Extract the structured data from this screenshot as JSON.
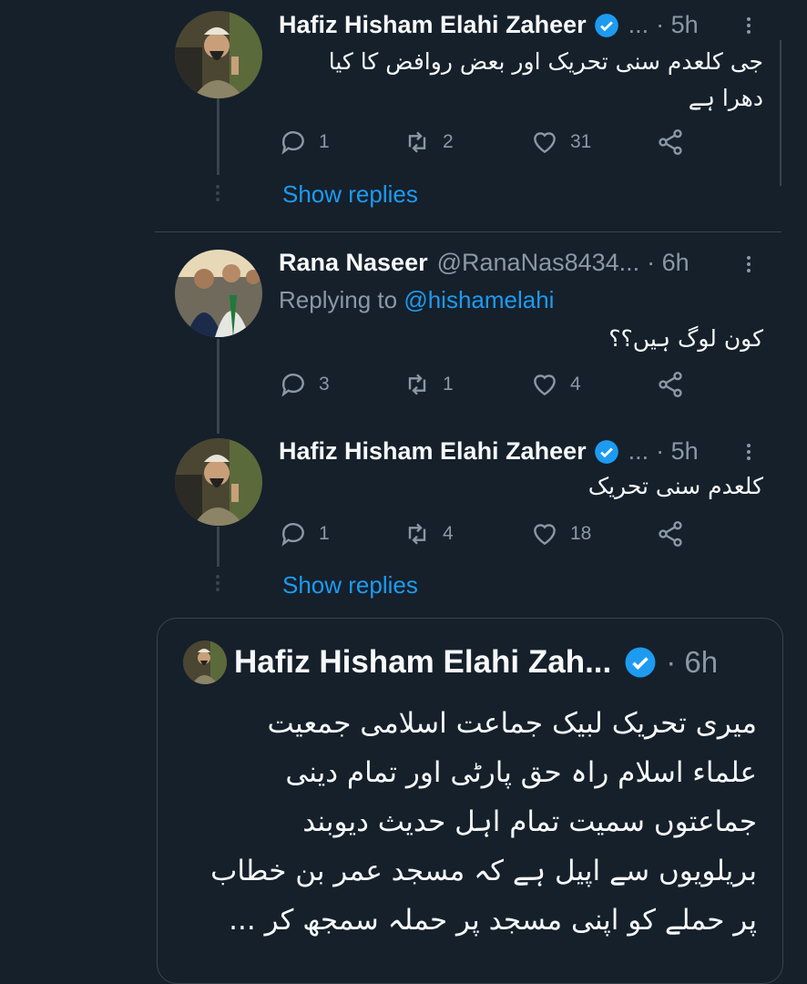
{
  "tweets": [
    {
      "name": "Hafiz Hisham Elahi Zaheer",
      "ellipsis": "...",
      "time": "· 5h",
      "text_lines": [
        "جی کلعدم سنی تحریک اور بعض روافض کا کیا",
        "دھرا ہے"
      ],
      "replies": "1",
      "retweets": "2",
      "likes": "31",
      "show_replies": "Show replies"
    },
    {
      "name": "Rana Naseer",
      "handle": "@RanaNas8434...",
      "time": "· 6h",
      "replying_prefix": "Replying to ",
      "replying_to": "@hishamelahi",
      "text_lines": [
        "کون لوگ ہیں؟؟"
      ],
      "replies": "3",
      "retweets": "1",
      "likes": "4"
    },
    {
      "name": "Hafiz Hisham Elahi Zaheer",
      "ellipsis": "...",
      "time": "· 5h",
      "text_lines": [
        "کلعدم سنی تحریک"
      ],
      "replies": "1",
      "retweets": "4",
      "likes": "18",
      "show_replies": "Show replies"
    }
  ],
  "quote": {
    "name": "Hafiz Hisham Elahi Zah...",
    "time": "· 6h",
    "text_lines": [
      "میری تحریک لبیک جماعت اسلامی جمعیت",
      "علماء اسلام راہ حق پارٹی اور تمام دینی",
      "جماعتوں سمیت تمام  اہل حدیث دیوبند",
      "بریلویوں سے اپیل ہے کہ مسجد عمر بن خطاب",
      "پر حملے کو اپنی مسجد پر حملہ سمجھ کر ..."
    ]
  },
  "colors": {
    "background": "#15202b",
    "accent": "#1d9bf0",
    "secondary_text": "#8b98a5",
    "divider": "#38444d"
  },
  "icons": [
    "reply-icon",
    "retweet-icon",
    "like-icon",
    "share-icon",
    "verified-badge-icon",
    "more-icon"
  ]
}
